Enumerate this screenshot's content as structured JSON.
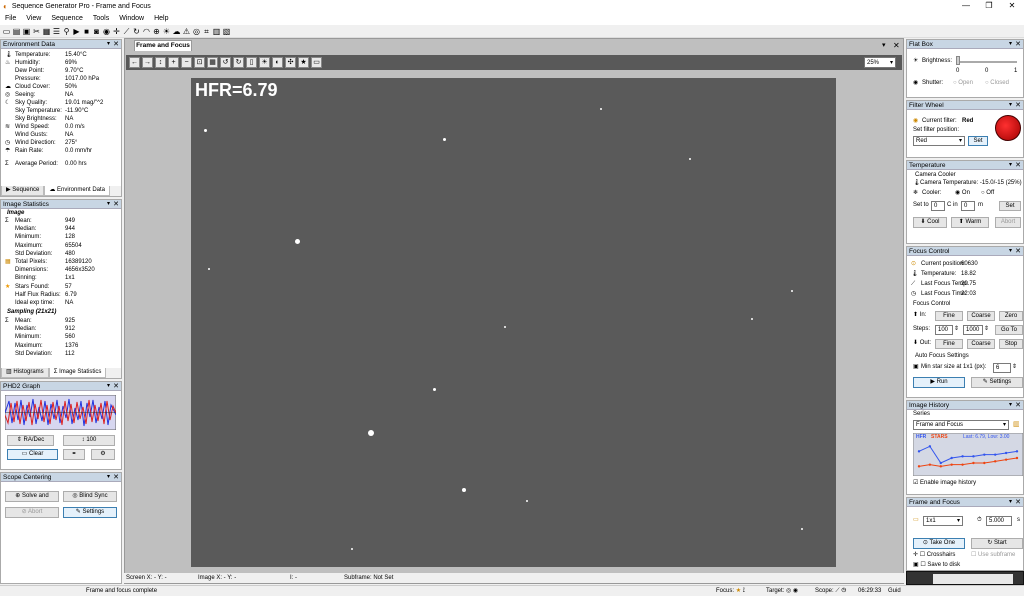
{
  "window": {
    "title": "Sequence Generator Pro - Frame and Focus"
  },
  "menu": [
    "File",
    "View",
    "Sequence",
    "Tools",
    "Window",
    "Help"
  ],
  "env": {
    "title": "Environment Data",
    "rows": [
      {
        "label": "Temperature:",
        "value": "15.40°C"
      },
      {
        "label": "Humidity:",
        "value": "69%"
      },
      {
        "label": "Dew Point:",
        "value": "9.70°C"
      },
      {
        "label": "Pressure:",
        "value": "1017.00 hPa"
      },
      {
        "label": "Cloud Cover:",
        "value": "50%"
      },
      {
        "label": "Seeing:",
        "value": "NA"
      },
      {
        "label": "Sky Quality:",
        "value": "19.01 mag/\"^2"
      },
      {
        "label": "Sky Temperature:",
        "value": "-11.90°C"
      },
      {
        "label": "Sky Brightness:",
        "value": "NA"
      },
      {
        "label": "Wind Speed:",
        "value": "0.0 m/s"
      },
      {
        "label": "Wind Gusts:",
        "value": "NA"
      },
      {
        "label": "Wind Direction:",
        "value": "275°"
      },
      {
        "label": "Rain Rate:",
        "value": "0.0 mm/hr"
      }
    ],
    "avg_label": "Average Period:",
    "avg_value": "0.00 hrs",
    "tabs": [
      "Sequence",
      "Environment Data"
    ]
  },
  "stats": {
    "title": "Image Statistics",
    "image_header": "Image",
    "image_rows": [
      {
        "label": "Mean:",
        "value": "949"
      },
      {
        "label": "Median:",
        "value": "944"
      },
      {
        "label": "Minimum:",
        "value": "128"
      },
      {
        "label": "Maximum:",
        "value": "65504"
      },
      {
        "label": "Std Deviation:",
        "value": "480"
      },
      {
        "label": "Total Pixels:",
        "value": "16389120"
      },
      {
        "label": "Dimensions:",
        "value": "4656x3520"
      },
      {
        "label": "Binning:",
        "value": "1x1"
      },
      {
        "label": "Stars Found:",
        "value": "57"
      },
      {
        "label": "Half Flux Radius:",
        "value": "6.79"
      },
      {
        "label": "Ideal exp time:",
        "value": "NA"
      }
    ],
    "sampling_header": "Sampling (21x21)",
    "sampling_rows": [
      {
        "label": "Mean:",
        "value": "925"
      },
      {
        "label": "Median:",
        "value": "912"
      },
      {
        "label": "Minimum:",
        "value": "560"
      },
      {
        "label": "Maximum:",
        "value": "1376"
      },
      {
        "label": "Std Deviation:",
        "value": "112"
      }
    ],
    "tabs": [
      "Histograms",
      "Image Statistics"
    ]
  },
  "phd2": {
    "title": "PHD2 Graph",
    "radec": "RA/Dec",
    "scale": "100",
    "clear": "Clear"
  },
  "centering": {
    "title": "Scope Centering",
    "solve": "Solve and",
    "blind": "Blind Sync",
    "abort": "Abort",
    "settings": "Settings"
  },
  "doc": {
    "tab": "Frame and Focus",
    "zoom": "25%",
    "hfr": "HFR=6.79"
  },
  "status": {
    "screen": "Screen X: - Y: -",
    "image": "Image X: - Y: -",
    "i": "I: -",
    "subframe": "Subframe: Not Set"
  },
  "bottom": {
    "msg": "Frame and focus complete",
    "focus": "Focus:",
    "target": "Target:",
    "scope": "Scope:",
    "time": "06:29:33",
    "guide": "Guid"
  },
  "flatbox": {
    "title": "Flat Box",
    "brightness": "Brightness:",
    "ticks": [
      "0",
      "0",
      "1"
    ],
    "shutter": "Shutter:",
    "open": "Open",
    "closed": "Closed"
  },
  "filter": {
    "title": "Filter Wheel",
    "current_label": "Current filter:",
    "current": "Red",
    "set_label": "Set filter position:",
    "select": "Red",
    "set": "Set"
  },
  "temp": {
    "title": "Temperature",
    "cooler_header": "Camera Cooler",
    "cam_temp": "Camera Temperature: -15.0/-15 (25%)",
    "cooler": "Cooler:",
    "on": "On",
    "off": "Off",
    "setto": "Set to",
    "v1": "0",
    "c_in": "C in",
    "v2": "0",
    "m": "m",
    "set": "Set",
    "cool": "Cool",
    "warm": "Warm",
    "abort": "Abort"
  },
  "focus": {
    "title": "Focus Control",
    "rows": [
      {
        "label": "Current position:",
        "value": "60630"
      },
      {
        "label": "Temperature:",
        "value": "18.82"
      },
      {
        "label": "Last Focus Temp:",
        "value": "20.75"
      },
      {
        "label": "Last Focus Time:",
        "value": "22:03"
      }
    ],
    "fc_header": "Focus Control",
    "in": "In:",
    "fine": "Fine",
    "coarse": "Coarse",
    "zero": "Zero",
    "steps": "Steps:",
    "s1": "100",
    "s2": "1000",
    "goto": "Go To",
    "out": "Out:",
    "stop": "Stop",
    "af_header": "Auto Focus Settings",
    "minstar": "Min star size at 1x1 (px):",
    "minstar_v": "6",
    "run": "Run",
    "settings": "Settings"
  },
  "history": {
    "title": "Image History",
    "series_label": "Series",
    "series": "Frame and Focus",
    "legend_hfr": "HFR",
    "legend_stars": "STARS",
    "legend_last": "Last: 6.79, Low: 3.00",
    "enable": "Enable image history"
  },
  "ff": {
    "title": "Frame and Focus",
    "bin": "1x1",
    "exp": "5.000",
    "unit": "s",
    "take": "Take One",
    "start": "Start",
    "crosshairs": "Crosshairs",
    "subframe": "Use subframe",
    "save": "Save to disk"
  },
  "chart_data": {
    "type": "line",
    "series": [
      {
        "name": "HFR",
        "values": [
          6.5,
          8.0,
          3.0,
          4.5,
          5.0,
          5.0,
          5.5,
          5.5,
          6.0,
          6.5
        ]
      },
      {
        "name": "STARS",
        "values": [
          2.0,
          2.5,
          2.0,
          2.5,
          2.5,
          3.0,
          3.0,
          3.5,
          4.0,
          4.5
        ]
      }
    ],
    "colors": {
      "HFR": "#3355ee",
      "STARS": "#ee4411"
    }
  },
  "colors": {
    "panel_header": "#c8d6e4",
    "image_bg": "#5a5a5a",
    "toolbar_dark": "#595959"
  }
}
